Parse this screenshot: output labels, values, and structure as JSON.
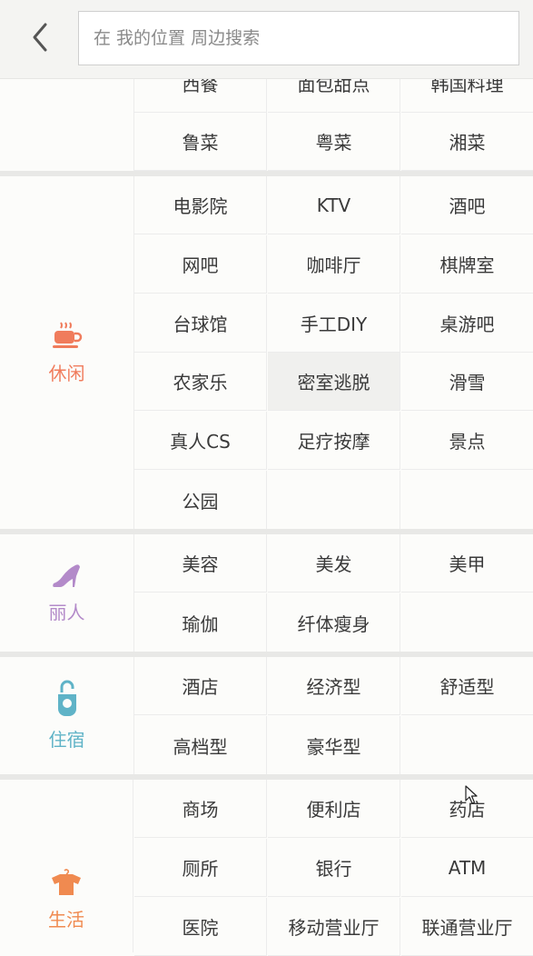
{
  "search": {
    "placeholder": "在 我的位置 周边搜索"
  },
  "colors": {
    "leisure": "#f07c5c",
    "beauty": "#b38ac9",
    "lodging": "#5fb3c7",
    "life": "#f08a50"
  },
  "groups": {
    "food": {
      "name": "",
      "items": [
        "西餐",
        "面包甜点",
        "韩国料理",
        "鲁菜",
        "粤菜",
        "湘菜"
      ]
    },
    "leisure": {
      "name": "休闲",
      "icon": "coffee-cup-icon",
      "items": [
        "电影院",
        "KTV",
        "酒吧",
        "网吧",
        "咖啡厅",
        "棋牌室",
        "台球馆",
        "手工DIY",
        "桌游吧",
        "农家乐",
        "密室逃脱",
        "滑雪",
        "真人CS",
        "足疗按摩",
        "景点",
        "公园"
      ],
      "highlighted": "密室逃脱"
    },
    "beauty": {
      "name": "丽人",
      "icon": "high-heel-icon",
      "items": [
        "美容",
        "美发",
        "美甲",
        "瑜伽",
        "纤体瘦身"
      ]
    },
    "lodging": {
      "name": "住宿",
      "icon": "door-hanger-icon",
      "items": [
        "酒店",
        "经济型",
        "舒适型",
        "高档型",
        "豪华型"
      ]
    },
    "life": {
      "name": "生活",
      "icon": "shirt-icon",
      "items": [
        "商场",
        "便利店",
        "药店",
        "厕所",
        "银行",
        "ATM",
        "医院",
        "移动营业厅",
        "联通营业厅"
      ]
    }
  }
}
